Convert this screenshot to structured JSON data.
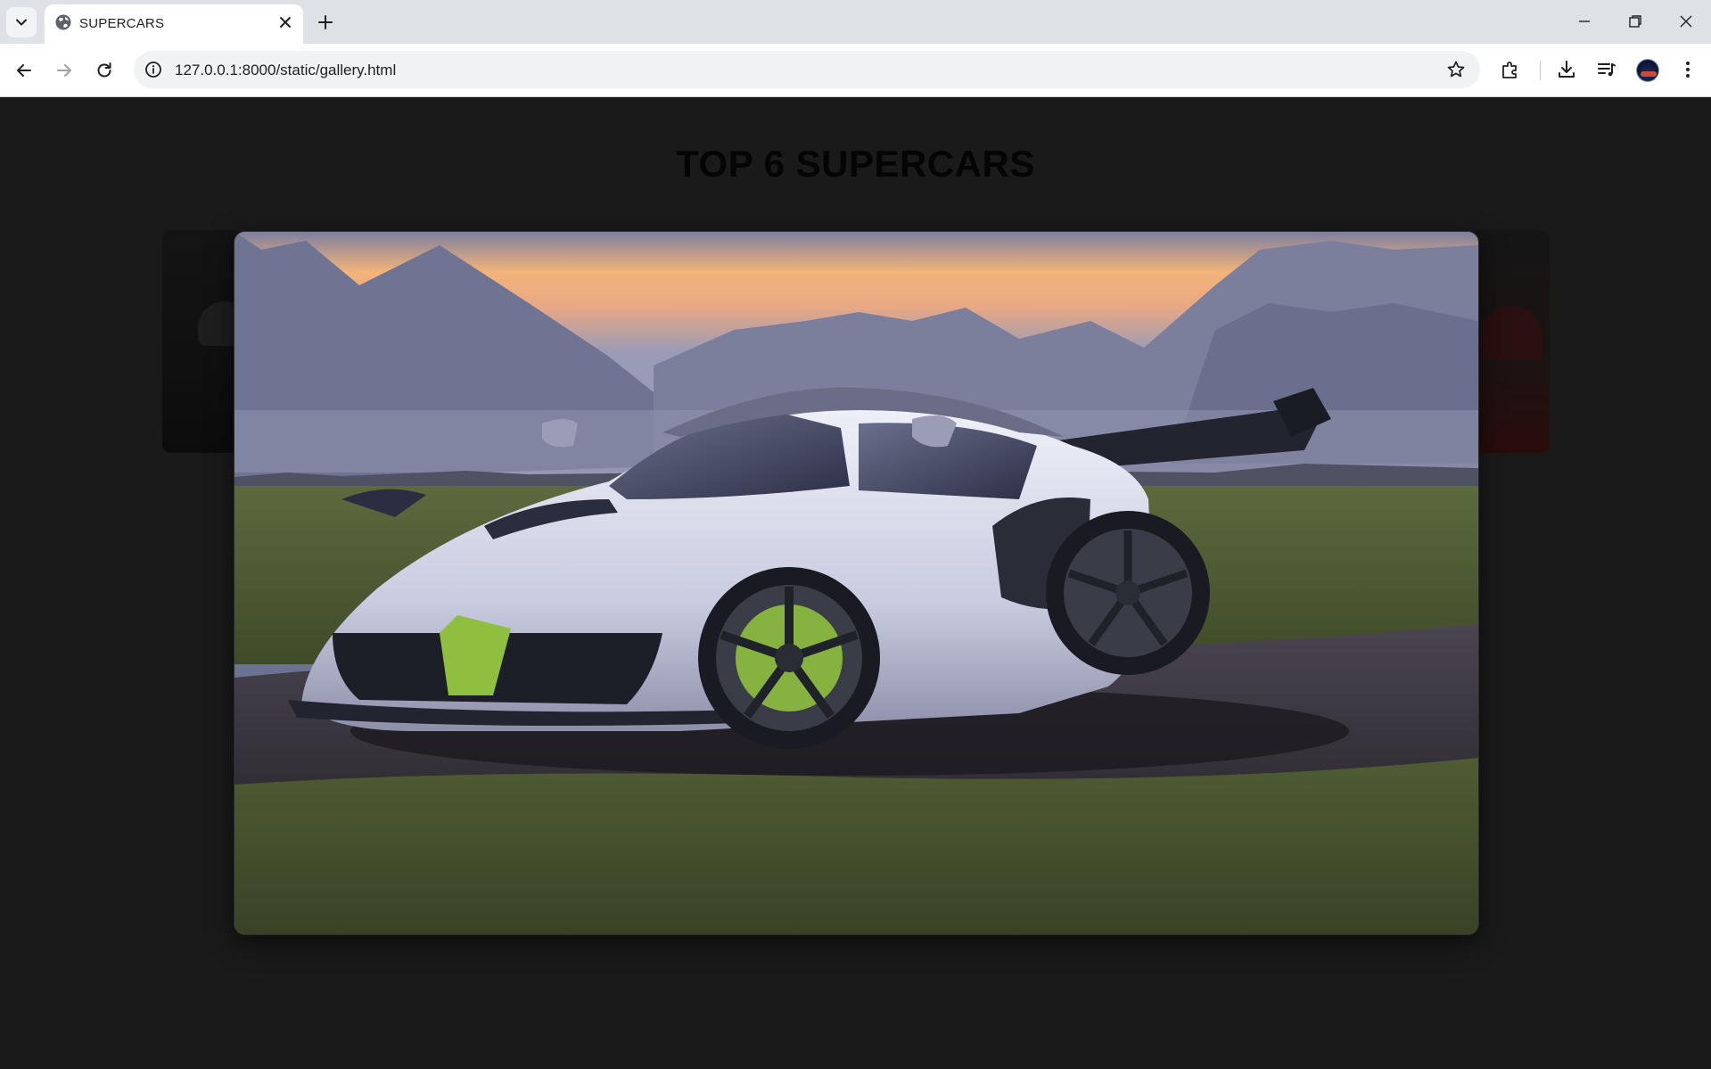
{
  "browser": {
    "tab_title": "SUPERCARS",
    "url": "127.0.0.1:8000/static/gallery.html"
  },
  "page": {
    "title": "TOP 6 SUPERCARS"
  },
  "lightbox": {
    "image_alt": "Supercar photo"
  },
  "colors": {
    "page_background": "#1a1a1a",
    "title_color": "#050505",
    "tabstrip": "#dee1e6"
  },
  "icons": [
    "tab-search-icon",
    "globe-icon",
    "close-icon",
    "plus-icon",
    "minimize-icon",
    "restore-icon",
    "window-close-icon",
    "back-icon",
    "forward-icon",
    "reload-icon",
    "info-icon",
    "star-icon",
    "extensions-icon",
    "download-icon",
    "media-controls-icon",
    "menu-icon"
  ]
}
